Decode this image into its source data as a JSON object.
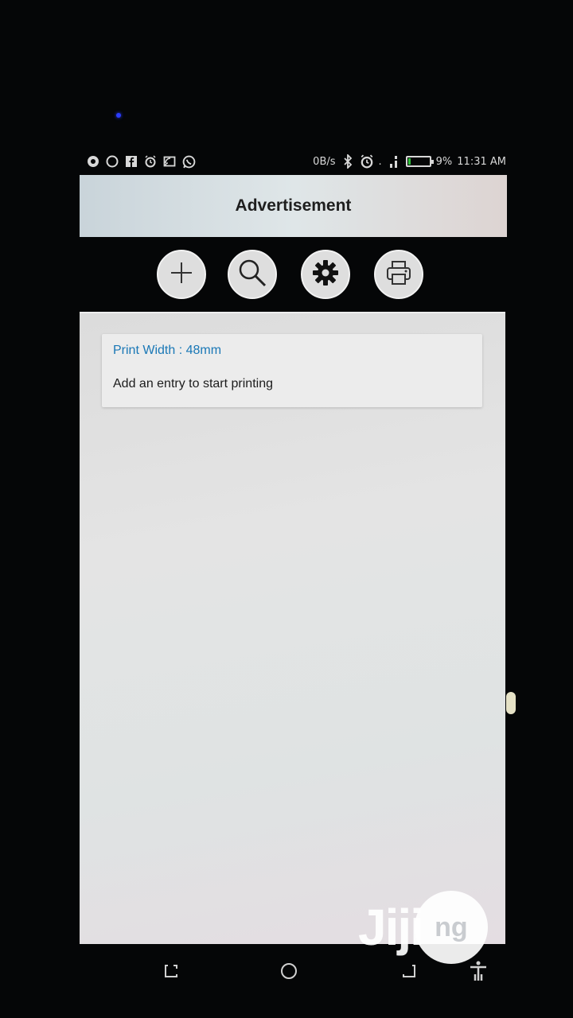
{
  "status_bar": {
    "net_speed": "0B/s",
    "signal_dot": ".",
    "battery_percent": "9%",
    "battery_level": 0.09,
    "time": "11:31 AM",
    "left_icons": [
      "chrome-icon",
      "chat-bubble-icon",
      "facebook-icon",
      "alarm-icon",
      "cast-icon",
      "whatsapp-icon"
    ],
    "right_icons": [
      "bluetooth-icon",
      "alarm-icon",
      "signal-icon",
      "battery-icon"
    ]
  },
  "app_bar": {
    "title": "Advertisement"
  },
  "toolbar": {
    "buttons": [
      {
        "icon": "plus-icon"
      },
      {
        "icon": "search-icon"
      },
      {
        "icon": "gear-icon"
      },
      {
        "icon": "printer-icon"
      }
    ]
  },
  "card": {
    "title": "Print Width : 48mm",
    "message": "Add an entry to start printing"
  },
  "watermark": {
    "brand": "Jiji",
    "suffix": "ng"
  },
  "colors": {
    "accent": "#1a78b6",
    "battery_green": "#2fbf3a",
    "background": "#050607"
  }
}
